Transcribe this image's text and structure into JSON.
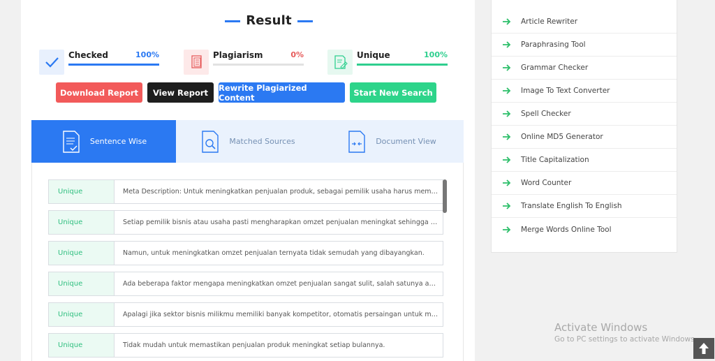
{
  "result": {
    "title": "Result"
  },
  "stats": [
    {
      "label": "Checked",
      "value": "100%",
      "color": "#2b79f2",
      "icon": "checkmark-icon",
      "progress": 1.0
    },
    {
      "label": "Plagiarism",
      "value": "0%",
      "color": "#e65b5b",
      "icon": "document-copy-icon",
      "progress": 0.0
    },
    {
      "label": "Unique",
      "value": "100%",
      "color": "#2fcf8f",
      "icon": "document-edit-icon",
      "progress": 1.0
    }
  ],
  "buttons": [
    {
      "label": "Download Report",
      "color": "#f25a5a"
    },
    {
      "label": "View Report",
      "color": "#1e1e1e"
    },
    {
      "label": "Rewrite Plagiarized Content",
      "color": "#2b79f2"
    },
    {
      "label": "Start New Search",
      "color": "#2dd48a"
    }
  ],
  "tabs": [
    {
      "label": "Sentence Wise",
      "active": true,
      "icon": "document-list-icon"
    },
    {
      "label": "Matched Sources",
      "active": false,
      "icon": "document-search-icon"
    },
    {
      "label": "Document View",
      "active": false,
      "icon": "document-compare-icon"
    }
  ],
  "sentences": [
    {
      "status": "Unique",
      "text": "Meta Description: Untuk meningkatkan penjualan produk, sebagai pemilik usaha harus memiliki beberapa ..."
    },
    {
      "status": "Unique",
      "text": "Setiap pemilik bisnis atau usaha pasti mengharapkan omzet penjualan meningkat sehingga target keuntun..."
    },
    {
      "status": "Unique",
      "text": "Namun, untuk meningkatkan omzet penjualan ternyata tidak semudah yang dibayangkan."
    },
    {
      "status": "Unique",
      "text": "Ada beberapa faktor mengapa meningkatkan omzet penjualan sangat sulit, salah satunya adalah faktor ko..."
    },
    {
      "status": "Unique",
      "text": "Apalagi jika sektor bisnis milikmu memiliki banyak kompetitor, otomatis persaingan untuk meningkatkan pe..."
    },
    {
      "status": "Unique",
      "text": "Tidak mudah untuk memastikan penjualan produk meningkat setiap bulannya."
    }
  ],
  "sidebar": {
    "items": [
      "Article Rewriter",
      "Paraphrasing Tool",
      "Grammar Checker",
      "Image To Text Converter",
      "Spell Checker",
      "Online MD5 Generator",
      "Title Capitalization",
      "Word Counter",
      "Translate English To English",
      "Merge Words Online Tool"
    ],
    "arrow_color": "#2dbf6a"
  },
  "watermark": {
    "title": "Activate Windows",
    "subtitle": "Go to PC settings to activate Windows."
  }
}
